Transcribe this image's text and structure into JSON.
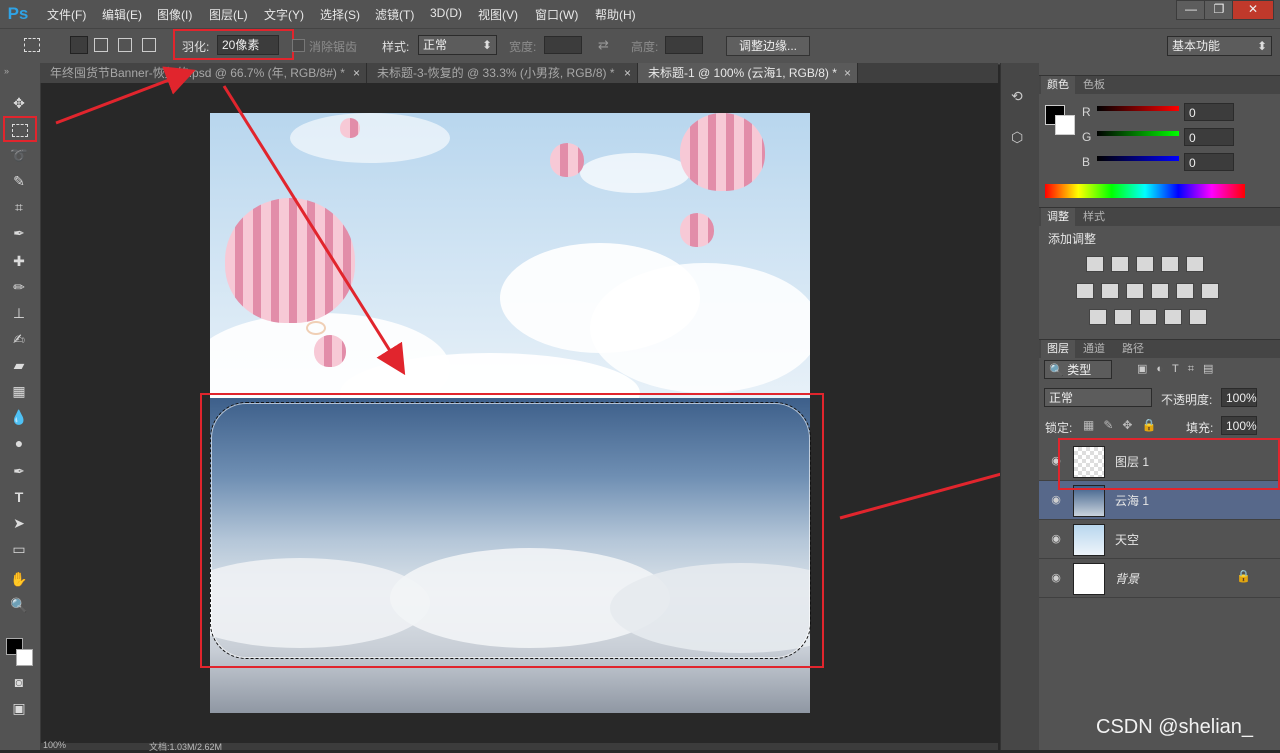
{
  "app": {
    "logo": "Ps"
  },
  "menu": [
    "文件(F)",
    "编辑(E)",
    "图像(I)",
    "图层(L)",
    "文字(Y)",
    "选择(S)",
    "滤镜(T)",
    "3D(D)",
    "视图(V)",
    "窗口(W)",
    "帮助(H)"
  ],
  "window_buttons": [
    "—",
    "❐",
    "✕"
  ],
  "options": {
    "feather_label": "羽化:",
    "feather_value": "20像素",
    "antialias_label": "消除锯齿",
    "style_label": "样式:",
    "style_value": "正常",
    "width_label": "宽度:",
    "height_label": "高度:",
    "refine_button": "调整边缘...",
    "workspace": "基本功能"
  },
  "tabs": [
    {
      "label": "年终囤货节Banner-恢复的.psd @ 66.7% (年, RGB/8#) *"
    },
    {
      "label": "未标题-3-恢复的 @ 33.3% (小男孩, RGB/8) *"
    },
    {
      "label": "未标题-1 @ 100% (云海1, RGB/8) *"
    }
  ],
  "tab_close": "×",
  "status": {
    "zoom": "100%",
    "doc": "文档:1.03M/2.62M"
  },
  "color_panel": {
    "tabs": [
      "颜色",
      "色板"
    ],
    "r_label": "R",
    "g_label": "G",
    "b_label": "B",
    "r_value": "0",
    "g_value": "0",
    "b_value": "0"
  },
  "adjust_panel": {
    "tabs": [
      "调整",
      "样式"
    ],
    "title": "添加调整"
  },
  "layers_panel": {
    "tabs": [
      "图层",
      "通道",
      "路径"
    ],
    "filter_label": "类型",
    "blend_mode": "正常",
    "opacity_label": "不透明度:",
    "opacity_value": "100%",
    "lock_label": "锁定:",
    "fill_label": "填充:",
    "fill_value": "100%",
    "layers": [
      {
        "name": "图层 1"
      },
      {
        "name": "云海 1"
      },
      {
        "name": "天空"
      },
      {
        "name": "背景"
      }
    ]
  },
  "watermark": "CSDN @shelian_",
  "colors": {
    "accent_red": "#e1252d",
    "selected_layer": "#57688a"
  }
}
